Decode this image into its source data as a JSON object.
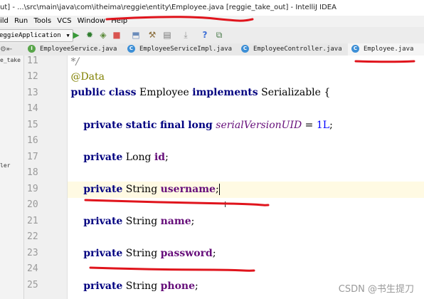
{
  "window": {
    "title": "ut] - ...\\src\\main\\java\\com\\itheima\\reggie\\entity\\Employee.java [reggie_take_out] - IntelliJ IDEA"
  },
  "menu": [
    "ild",
    "Run",
    "Tools",
    "VCS",
    "Window",
    "Help"
  ],
  "toolbar": {
    "run_config": "eggieApplication",
    "icons": [
      "run-icon",
      "debug-icon",
      "coverage-icon",
      "stop-icon",
      "build-icon",
      "sdk-icon",
      "structure-icon",
      "help-icon",
      "vcs-icon"
    ]
  },
  "tabs": [
    {
      "label": "EmployeeService.java",
      "kind": "interface",
      "badge": "I"
    },
    {
      "label": "EmployeeServiceImpl.java",
      "kind": "class",
      "badge": "C"
    },
    {
      "label": "EmployeeController.java",
      "kind": "class",
      "badge": "C"
    },
    {
      "label": "Employee.java",
      "kind": "class",
      "badge": "C",
      "active": true
    }
  ],
  "project_panel": {
    "text1": "e_take",
    "text2": "ler"
  },
  "line_numbers": [
    "11",
    "12",
    "13",
    "14",
    "15",
    "16",
    "17",
    "18",
    "19",
    "20",
    "21",
    "22",
    "23",
    "24",
    "25"
  ],
  "code": {
    "l11": "*/",
    "l12_annotation": "@Data",
    "l13": {
      "kw1": "public",
      "kw2": "class",
      "name": "Employee",
      "kw3": "implements",
      "iface": "Serializable",
      "brace": "{"
    },
    "l15": {
      "kw1": "private",
      "kw2": "static",
      "kw3": "final",
      "kw4": "long",
      "field": "serialVersionUID",
      "eq": "=",
      "value": "1L",
      "semi": ";"
    },
    "l17": {
      "kw": "private",
      "type": "Long",
      "field": "id",
      "semi": ";"
    },
    "l19": {
      "kw": "private",
      "type": "String",
      "field": "username",
      "semi": ";"
    },
    "l21": {
      "kw": "private",
      "type": "String",
      "field": "name",
      "semi": ";"
    },
    "l23": {
      "kw": "private",
      "type": "String",
      "field": "password",
      "semi": ";"
    },
    "l25": {
      "kw": "private",
      "type": "String",
      "field": "phone",
      "semi": ";"
    }
  },
  "watermark": "CSDN @书生提刀",
  "colors": {
    "annotation_ink": "#e0141c",
    "keyword": "#000080",
    "field": "#660e7a"
  }
}
